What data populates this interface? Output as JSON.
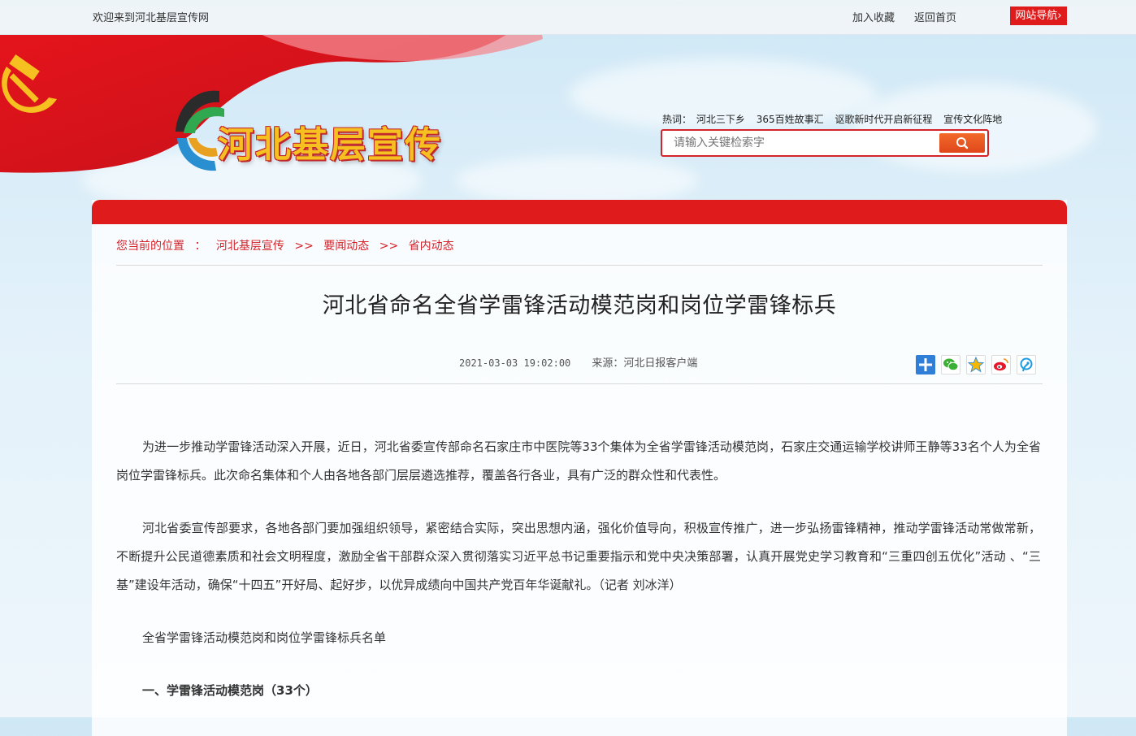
{
  "topbar": {
    "welcome": "欢迎来到河北基层宣传网",
    "favorite": "加入收藏",
    "home": "返回首页",
    "site_nav": "网站导航"
  },
  "header": {
    "site_title": "河北基层宣传",
    "hot_label": "热词：",
    "hot_words": [
      "河北三下乡",
      "365百姓故事汇",
      "讴歌新时代开启新征程",
      "宣传文化阵地"
    ],
    "search_placeholder": "请输入关键检索字"
  },
  "breadcrumb": {
    "label": "您当前的位置",
    "colon": "：",
    "items": [
      "河北基层宣传",
      "要闻动态",
      "省内动态"
    ],
    "separator": ">>"
  },
  "article": {
    "title": "河北省命名全省学雷锋活动模范岗和岗位学雷锋标兵",
    "date": "2021-03-03 19:02:00",
    "source": "来源：河北日报客户端",
    "paragraphs": [
      "为进一步推动学雷锋活动深入开展，近日，河北省委宣传部命名石家庄市中医院等33个集体为全省学雷锋活动模范岗，石家庄交通运输学校讲师王静等33名个人为全省岗位学雷锋标兵。此次命名集体和个人由各地各部门层层遴选推荐，覆盖各行各业，具有广泛的群众性和代表性。",
      "河北省委宣传部要求，各地各部门要加强组织领导，紧密结合实际，突出思想内涵，强化价值导向，积极宣传推广，进一步弘扬雷锋精神，推动学雷锋活动常做常新，不断提升公民道德素质和社会文明程度，激励全省干部群众深入贯彻落实习近平总书记重要指示和党中央决策部署，认真开展党史学习教育和“三重四创五优化”活动 、“三基”建设年活动，确保“十四五”开好局、起好步，以优异成绩向中国共产党百年华诞献礼。（记者  刘冰洋）"
    ],
    "list_title": "全省学雷锋活动模范岗和岗位学雷锋标兵名单",
    "section1": "一、学雷锋活动模范岗（33个）"
  },
  "share_icons": [
    "plus-icon",
    "wechat-icon",
    "qzone-icon",
    "weibo-icon",
    "tencent-weibo-icon"
  ],
  "colors": {
    "brand_red": "#e01b1b",
    "search_orange": "#f05a22",
    "logo_yellow": "#f6c020"
  }
}
